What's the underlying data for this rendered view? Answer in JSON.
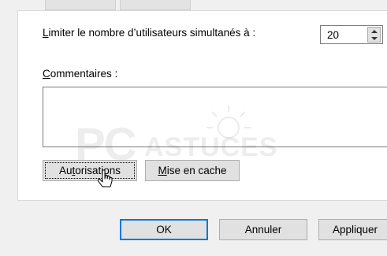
{
  "dialog": {
    "user_limit_label_prefix": "L",
    "user_limit_label_rest": "imiter le nombre d’utilisateurs simultanés à :",
    "user_limit_value": "20",
    "comments_label_prefix": "C",
    "comments_label_rest": "ommentaires :",
    "comments_value": "",
    "permissions_button": {
      "pre": "Au",
      "mn": "t",
      "post": "orisations"
    },
    "caching_button": {
      "pre": "",
      "mn": "M",
      "post": "ise en cache"
    }
  },
  "footer": {
    "ok_label": "OK",
    "cancel_label": "Annuler",
    "apply_label": "Appliquer"
  },
  "watermark": {
    "pc": "PC",
    "astuces": "ASTUCES"
  },
  "colors": {
    "window_bg": "#f0f0f0",
    "panel_bg": "#ffffff",
    "default_button_border": "#0078d7"
  },
  "icons": [
    "spin-up-icon",
    "spin-down-icon",
    "mouse-cursor-icon",
    "sun-watermark-icon"
  ]
}
